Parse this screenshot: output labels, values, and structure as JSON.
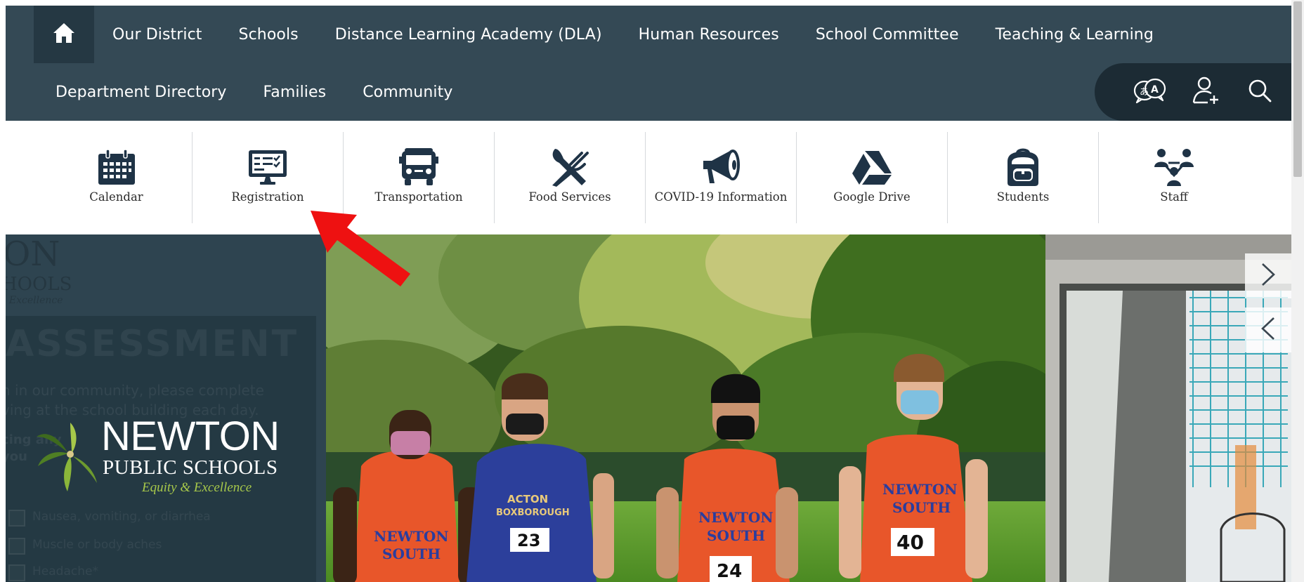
{
  "nav": {
    "primary": [
      {
        "label": "Our District"
      },
      {
        "label": "Schools"
      },
      {
        "label": "Distance Learning Academy (DLA)"
      },
      {
        "label": "Human Resources"
      },
      {
        "label": "School Committee"
      },
      {
        "label": "Teaching & Learning"
      }
    ],
    "secondary": [
      {
        "label": "Department Directory"
      },
      {
        "label": "Families"
      },
      {
        "label": "Community"
      }
    ],
    "icons": {
      "home": "home-icon",
      "translate": "translate-icon",
      "account": "user-add-icon",
      "search": "search-icon"
    }
  },
  "quick_links": [
    {
      "label": "Calendar",
      "icon": "calendar-icon"
    },
    {
      "label": "Registration",
      "icon": "monitor-checklist-icon"
    },
    {
      "label": "Transportation",
      "icon": "school-bus-icon"
    },
    {
      "label": "Food Services",
      "icon": "fork-knife-icon"
    },
    {
      "label": "COVID-19 Information",
      "icon": "megaphone-icon"
    },
    {
      "label": "Google Drive",
      "icon": "google-drive-icon"
    },
    {
      "label": "Students",
      "icon": "backpack-icon"
    },
    {
      "label": "Staff",
      "icon": "staff-group-icon"
    }
  ],
  "hero": {
    "logo": {
      "name": "NEWTON",
      "subtitle": "PUBLIC SCHOOLS",
      "tagline": "Equity & Excellence"
    },
    "bib_numbers": [
      "23",
      "24",
      "40"
    ],
    "jersey_text": [
      "NEWTON SOUTH",
      "ACTON BOXBOROUGH"
    ]
  },
  "background_panel": {
    "fragments": [
      "ON",
      "HOOLS",
      "l Excellence"
    ],
    "heading": "ASSESSMENT",
    "lines": [
      "n in our community, please complete",
      "ving at the school building each day.",
      "cing any",
      "you"
    ],
    "items": [
      "Nausea, vomiting, or diarrhea",
      "Muscle or body aches",
      "Headache*"
    ]
  },
  "colors": {
    "nav_bg": "#344955",
    "nav_dark": "#253843",
    "utility_bg": "#1c2b34",
    "icon_navy": "#1f3346",
    "accent_green": "#a7c84a",
    "arrow_red": "#ee1111"
  }
}
